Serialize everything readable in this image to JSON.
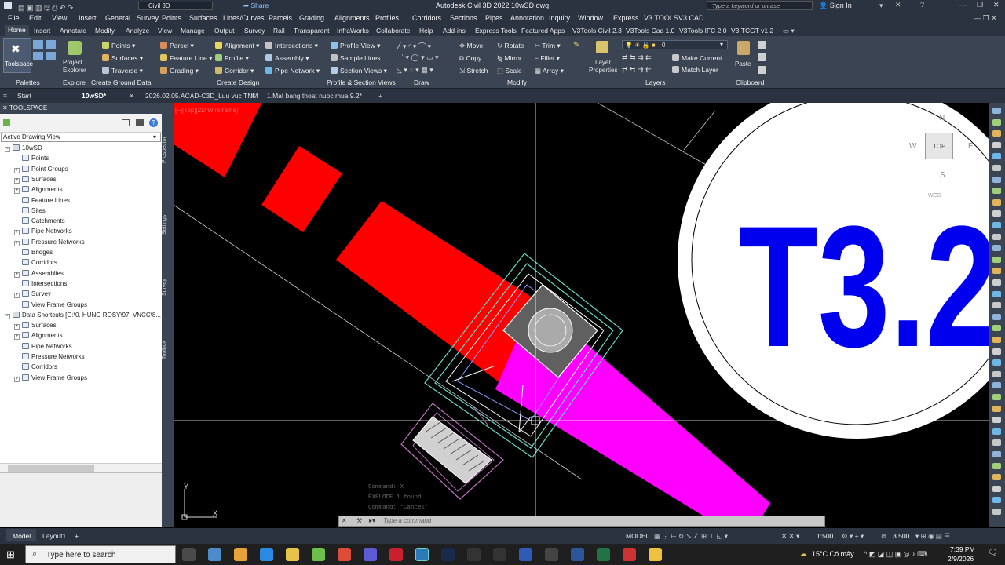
{
  "titlebar": {
    "workspace": "Civil 3D",
    "share": "Share",
    "app_title": "Autodesk Civil 3D 2022   10wSD.dwg",
    "search_placeholder": "Type a keyword or phrase",
    "sign_in": "Sign In"
  },
  "menubar": [
    "File",
    "Edit",
    "View",
    "Insert",
    "General",
    "Survey",
    "Points",
    "Surfaces",
    "Lines/Curves",
    "Parcels",
    "Grading",
    "Alignments",
    "Profiles",
    "Corridors",
    "Sections",
    "Pipes",
    "Annotation",
    "Inquiry",
    "Window",
    "Express",
    "V3.TOOLS",
    "V3.CAD"
  ],
  "ribbon_tabs": [
    "Home",
    "Insert",
    "Annotate",
    "Modify",
    "Analyze",
    "View",
    "Manage",
    "Output",
    "Survey",
    "Rail",
    "Transparent",
    "InfraWorks",
    "Collaborate",
    "Help",
    "Add-ins",
    "Express Tools",
    "Featured Apps",
    "V3Tools Civil 2.3",
    "V3Tools Cad 1.0",
    "V3Tools IFC 2.0",
    "V3.TCGT v1.2"
  ],
  "ribbon": {
    "toolspace": "Toolspace",
    "project_explorer_1": "Project",
    "project_explorer_2": "Explorer",
    "points": "Points",
    "surfaces": "Surfaces",
    "traverse": "Traverse",
    "parcel": "Parcel",
    "feature_line": "Feature Line",
    "grading": "Grading",
    "alignment": "Alignment",
    "profile": "Profile",
    "corridor": "Corridor",
    "intersections": "Intersections",
    "assembly": "Assembly",
    "pipe_network": "Pipe Network",
    "profile_view": "Profile View",
    "sample_lines": "Sample Lines",
    "section_views": "Section Views",
    "move": "Move",
    "copy": "Copy",
    "stretch": "Stretch",
    "rotate": "Rotate",
    "mirror": "Mirror",
    "scale": "Scale",
    "trim": "Trim",
    "fillet": "Fillet",
    "array": "Array",
    "layer_props_1": "Layer",
    "layer_props_2": "Properties",
    "layer_value": "0",
    "make_current": "Make Current",
    "match_layer": "Match Layer",
    "paste": "Paste",
    "panels": [
      "Palettes",
      "Explore",
      "Create Ground Data",
      "Create Design",
      "Profile & Section Views",
      "Draw",
      "Modify",
      "Layers",
      "Clipboard"
    ]
  },
  "doc_tabs": [
    "Start",
    "10wSD*",
    "2026.02.05.ACAD-C3D_Luu vuc TNM",
    "1.Mat bang thoat nuoc mua 9.2*"
  ],
  "toolspace": {
    "title": "TOOLSPACE",
    "view_select": "Active Drawing View",
    "tree": [
      {
        "label": "10wSD",
        "level": 0,
        "exp": "-"
      },
      {
        "label": "Points",
        "level": 2,
        "exp": ""
      },
      {
        "label": "Point Groups",
        "level": 1,
        "exp": "+"
      },
      {
        "label": "Surfaces",
        "level": 1,
        "exp": "+"
      },
      {
        "label": "Alignments",
        "level": 1,
        "exp": "+"
      },
      {
        "label": "Feature Lines",
        "level": 2,
        "exp": ""
      },
      {
        "label": "Sites",
        "level": 2,
        "exp": ""
      },
      {
        "label": "Catchments",
        "level": 2,
        "exp": ""
      },
      {
        "label": "Pipe Networks",
        "level": 1,
        "exp": "+"
      },
      {
        "label": "Pressure Networks",
        "level": 1,
        "exp": "+"
      },
      {
        "label": "Bridges",
        "level": 2,
        "exp": ""
      },
      {
        "label": "Corridors",
        "level": 2,
        "exp": ""
      },
      {
        "label": "Assemblies",
        "level": 1,
        "exp": "+"
      },
      {
        "label": "Intersections",
        "level": 2,
        "exp": ""
      },
      {
        "label": "Survey",
        "level": 1,
        "exp": "+"
      },
      {
        "label": "View Frame Groups",
        "level": 2,
        "exp": ""
      },
      {
        "label": "Data Shortcuts [G:\\0. HUNG ROSY\\97. VNCC\\8...",
        "level": 0,
        "exp": "-"
      },
      {
        "label": "Surfaces",
        "level": 1,
        "exp": "+"
      },
      {
        "label": "Alignments",
        "level": 1,
        "exp": "+"
      },
      {
        "label": "Pipe Networks",
        "level": 2,
        "exp": ""
      },
      {
        "label": "Pressure Networks",
        "level": 2,
        "exp": ""
      },
      {
        "label": "Corridors",
        "level": 2,
        "exp": ""
      },
      {
        "label": "View Frame Groups",
        "level": 1,
        "exp": "+"
      }
    ]
  },
  "side_labels": [
    "Prospector",
    "Settings",
    "Survey",
    "Toolbox"
  ],
  "viewport": {
    "label": "[−][Top][2D Wireframe]",
    "text_label": "T3.2",
    "viewcube": {
      "n": "N",
      "s": "S",
      "e": "E",
      "w": "W",
      "top": "TOP",
      "wcs": "WCS"
    },
    "history": [
      "Command: X",
      "EXPLODE 1 found",
      "Command: *Cancel*"
    ],
    "command_placeholder": "Type a command",
    "ucs_x": "X",
    "ucs_y": "Y"
  },
  "statusbar": {
    "model": "Model",
    "layout": "Layout1",
    "model_space": "MODEL",
    "scale": "1:500",
    "value": "3.500"
  },
  "taskbar": {
    "search_placeholder": "Type here to search",
    "weather": "15°C  Có mây",
    "time": "7:39 PM",
    "date": "2/9/2026"
  },
  "colors": {
    "red_band": "#ff0000",
    "magenta_band": "#ff00ff",
    "text_blue": "#0000ee",
    "cyan_lines": "#66d9c8"
  }
}
